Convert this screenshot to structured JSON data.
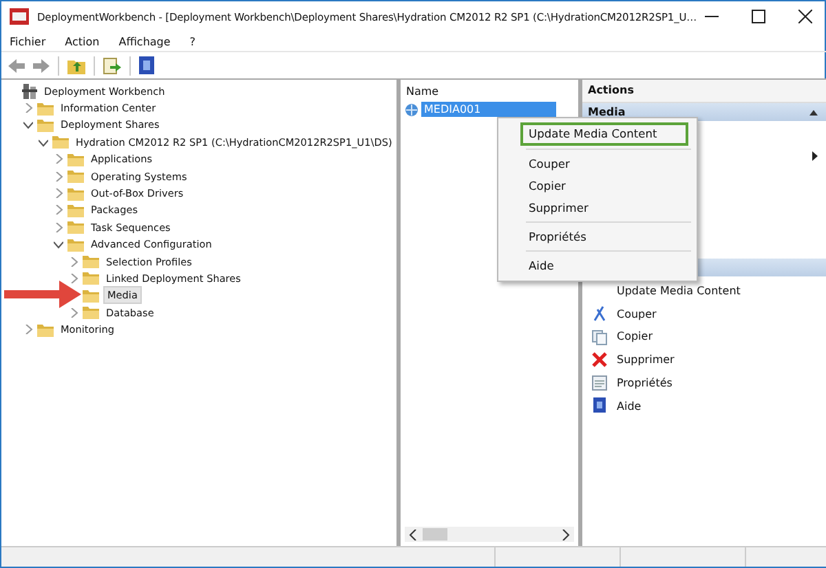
{
  "window": {
    "title": "DeploymentWorkbench - [Deployment Workbench\\Deployment Shares\\Hydration CM2012 R2 SP1 (C:\\HydrationCM2012R2SP1_U…"
  },
  "menu": [
    "Fichier",
    "Action",
    "Affichage",
    "?"
  ],
  "tree": [
    {
      "label": "Deployment Workbench",
      "kind": "root",
      "selected": false,
      "children": [
        {
          "label": "Information Center",
          "kind": "folder",
          "expanded": false,
          "selected": false
        },
        {
          "label": "Deployment Shares",
          "kind": "folder",
          "expanded": true,
          "selected": false,
          "children": [
            {
              "label": "Hydration CM2012 R2 SP1 (C:\\HydrationCM2012R2SP1_U1\\DS)",
              "kind": "folder",
              "expanded": true,
              "selected": false,
              "children": [
                {
                  "label": "Applications",
                  "kind": "folder",
                  "expanded": false,
                  "selected": false
                },
                {
                  "label": "Operating Systems",
                  "kind": "folder",
                  "expanded": false,
                  "selected": false
                },
                {
                  "label": "Out-of-Box Drivers",
                  "kind": "folder",
                  "expanded": false,
                  "selected": false
                },
                {
                  "label": "Packages",
                  "kind": "folder",
                  "expanded": false,
                  "selected": false
                },
                {
                  "label": "Task Sequences",
                  "kind": "folder",
                  "expanded": false,
                  "selected": false
                },
                {
                  "label": "Advanced Configuration",
                  "kind": "folder",
                  "expanded": true,
                  "selected": false,
                  "children": [
                    {
                      "label": "Selection Profiles",
                      "kind": "folder",
                      "expanded": false,
                      "selected": false
                    },
                    {
                      "label": "Linked Deployment Shares",
                      "kind": "folder",
                      "expanded": false,
                      "selected": false
                    },
                    {
                      "label": "Media",
                      "kind": "leaf",
                      "expanded": false,
                      "selected": true
                    },
                    {
                      "label": "Database",
                      "kind": "folder",
                      "expanded": false,
                      "selected": false
                    }
                  ]
                }
              ]
            }
          ]
        },
        {
          "label": "Monitoring",
          "kind": "folder",
          "expanded": false,
          "selected": false
        }
      ]
    }
  ],
  "list": {
    "column": "Name",
    "items": [
      {
        "label": "MEDIA001",
        "selected": true
      }
    ]
  },
  "actions": {
    "title": "Actions",
    "sections": [
      {
        "title": "Media"
      },
      {
        "items": [
          {
            "label": "Update Media Content",
            "kind": "none"
          },
          {
            "label": "Couper",
            "kind": "cut"
          },
          {
            "label": "Copier",
            "kind": "copy"
          },
          {
            "label": "Supprimer",
            "kind": "delete"
          },
          {
            "label": "Propriétés",
            "kind": "properties"
          },
          {
            "label": "Aide",
            "kind": "help"
          }
        ]
      }
    ]
  },
  "context_menu": {
    "groups": [
      [
        {
          "label": "Update Media Content",
          "highlighted": true
        }
      ],
      [
        {
          "label": "Couper",
          "highlighted": false
        },
        {
          "label": "Copier",
          "highlighted": false
        },
        {
          "label": "Supprimer",
          "highlighted": false
        }
      ],
      [
        {
          "label": "Propriétés",
          "highlighted": false
        }
      ],
      [
        {
          "label": "Aide",
          "highlighted": false
        }
      ]
    ]
  }
}
